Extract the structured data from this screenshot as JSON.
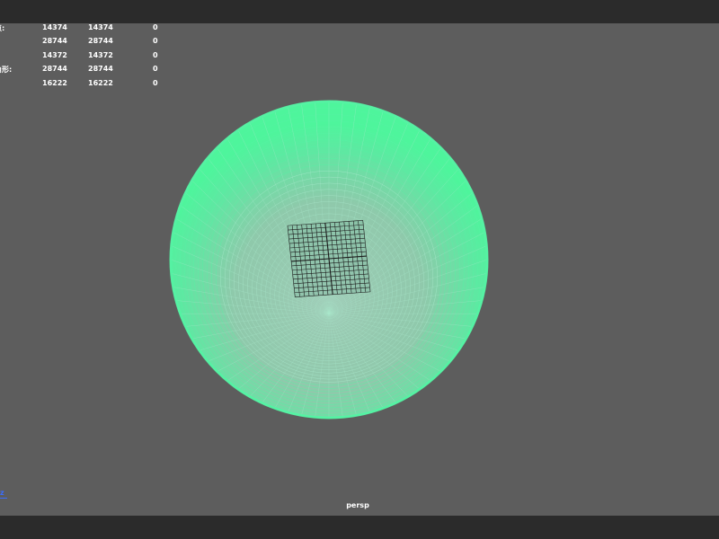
{
  "hud": {
    "rows": [
      {
        "label": "点:",
        "c1": "14374",
        "c2": "14374",
        "c3": "0"
      },
      {
        "label": "",
        "c1": "28744",
        "c2": "28744",
        "c3": "0"
      },
      {
        "label": "",
        "c1": "14372",
        "c2": "14372",
        "c3": "0"
      },
      {
        "label": "角形:",
        "c1": "28744",
        "c2": "28744",
        "c3": "0"
      },
      {
        "label": "",
        "c1": "16222",
        "c2": "16222",
        "c3": "0"
      }
    ]
  },
  "viewport": {
    "camera": "persp",
    "axis_label": "z"
  },
  "colors": {
    "wireframe": "#56f2a4",
    "wireframe_light": "#a9e8cc",
    "background": "#5d5d5d",
    "bar": "#2b2b2b",
    "plane": "#1c1c1c",
    "axis": "#3a6cff"
  }
}
